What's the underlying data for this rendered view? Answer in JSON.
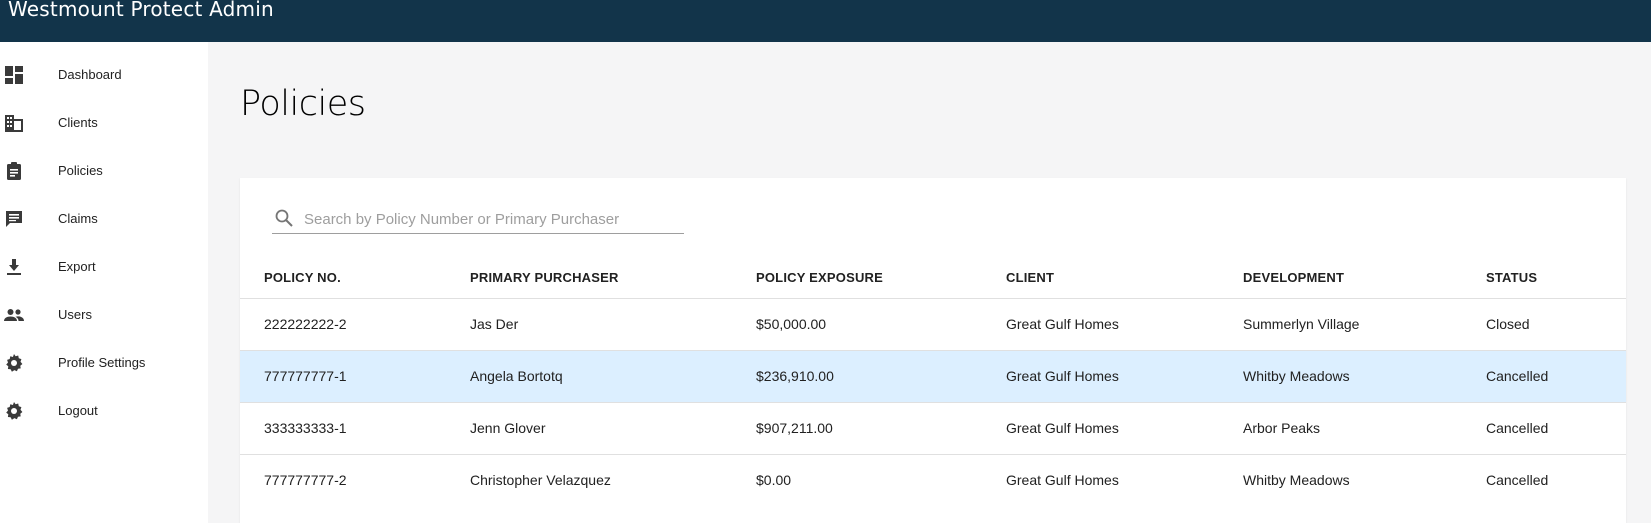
{
  "app": {
    "title": "Westmount Protect Admin"
  },
  "sidebar": {
    "items": [
      {
        "label": "Dashboard",
        "icon": "dashboard-icon"
      },
      {
        "label": "Clients",
        "icon": "building-icon"
      },
      {
        "label": "Policies",
        "icon": "clipboard-icon"
      },
      {
        "label": "Claims",
        "icon": "comment-icon"
      },
      {
        "label": "Export",
        "icon": "download-icon"
      },
      {
        "label": "Users",
        "icon": "people-icon"
      },
      {
        "label": "Profile Settings",
        "icon": "gear-icon"
      },
      {
        "label": "Logout",
        "icon": "gear-icon"
      }
    ]
  },
  "page": {
    "title": "Policies"
  },
  "search": {
    "placeholder": "Search by Policy Number or Primary Purchaser",
    "value": ""
  },
  "table": {
    "headers": [
      "POLICY NO.",
      "PRIMARY PURCHASER",
      "POLICY EXPOSURE",
      "CLIENT",
      "DEVELOPMENT",
      "STATUS"
    ],
    "rows": [
      [
        "222222222-2",
        "Jas Der",
        "$50,000.00",
        "Great Gulf Homes",
        "Summerlyn Village",
        "Closed"
      ],
      [
        "777777777-1",
        "Angela Bortotq",
        "$236,910.00",
        "Great Gulf Homes",
        "Whitby Meadows",
        "Cancelled"
      ],
      [
        "333333333-1",
        "Jenn Glover",
        "$907,211.00",
        "Great Gulf Homes",
        "Arbor Peaks",
        "Cancelled"
      ],
      [
        "777777777-2",
        "Christopher Velazquez",
        "$0.00",
        "Great Gulf Homes",
        "Whitby Meadows",
        "Cancelled"
      ]
    ],
    "selected_row": 1
  },
  "colors": {
    "appbar": "#12344a",
    "selected_row": "#dcefff",
    "background": "#f5f5f6"
  }
}
